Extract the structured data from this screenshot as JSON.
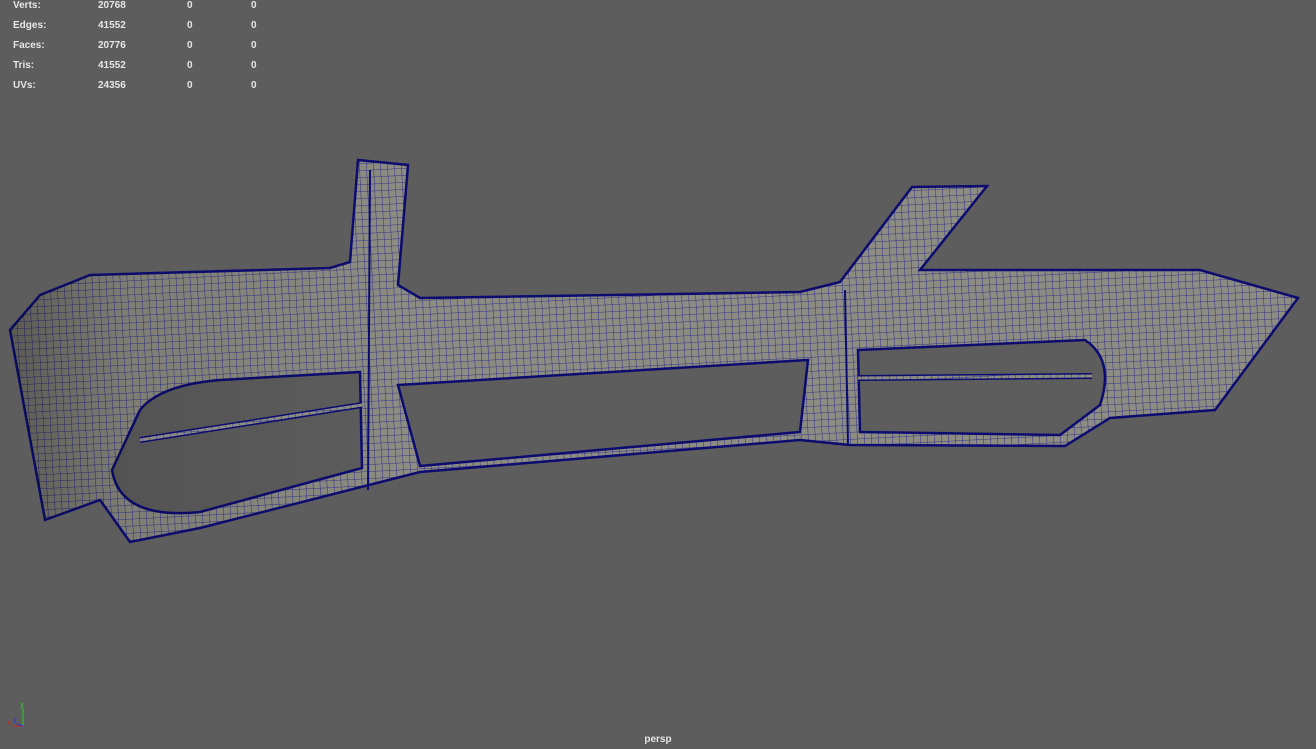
{
  "stats": [
    {
      "label": "Verts:",
      "total": "20768",
      "selected": "0",
      "component": "0"
    },
    {
      "label": "Edges:",
      "total": "41552",
      "selected": "0",
      "component": "0"
    },
    {
      "label": "Faces:",
      "total": "20776",
      "selected": "0",
      "component": "0"
    },
    {
      "label": "Tris:",
      "total": "41552",
      "selected": "0",
      "component": "0"
    },
    {
      "label": "UVs:",
      "total": "24356",
      "selected": "0",
      "component": "0"
    }
  ],
  "camera_label": "persp",
  "axis": {
    "x": "x",
    "y": "y",
    "z": "z"
  },
  "colors": {
    "background": "#5d5d5d",
    "wireframe": "#14148c",
    "surface": "#8c8c82"
  }
}
